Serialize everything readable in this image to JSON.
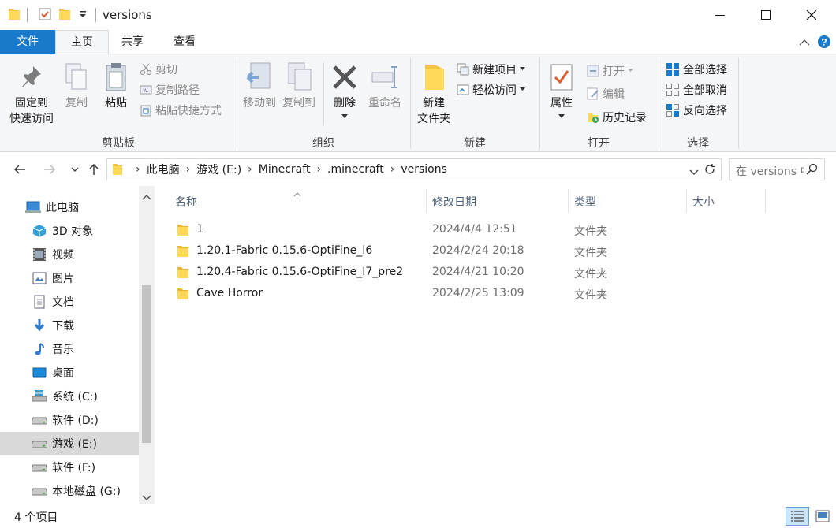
{
  "window": {
    "title": "versions",
    "minimize_label": "—",
    "maximize_label": "☐",
    "close_label": "✕"
  },
  "tabs": {
    "file": "文件",
    "home": "主页",
    "share": "共享",
    "view": "查看"
  },
  "ribbon": {
    "clipboard": {
      "label": "剪贴板",
      "pin": "固定到",
      "pin2": "快速访问",
      "copy": "复制",
      "paste": "粘贴",
      "cut": "剪切",
      "copy_path": "复制路径",
      "paste_shortcut": "粘贴快捷方式"
    },
    "organize": {
      "label": "组织",
      "move_to": "移动到",
      "copy_to": "复制到",
      "delete": "删除",
      "rename": "重命名"
    },
    "new": {
      "label": "新建",
      "new_folder": "新建",
      "new_folder2": "文件夹",
      "new_item": "新建项目",
      "easy_access": "轻松访问"
    },
    "open": {
      "label": "打开",
      "properties": "属性",
      "open": "打开",
      "edit": "编辑",
      "history": "历史记录"
    },
    "select": {
      "label": "选择",
      "select_all": "全部选择",
      "select_none": "全部取消",
      "invert": "反向选择"
    }
  },
  "address": {
    "breadcrumbs": [
      "此电脑",
      "游戏 (E:)",
      "Minecraft",
      ".minecraft",
      "versions"
    ],
    "search_placeholder": "在 versions 中搜索"
  },
  "nav": {
    "items": [
      {
        "label": "此电脑",
        "icon": "computer-icon"
      },
      {
        "label": "3D 对象",
        "icon": "3d-objects-icon"
      },
      {
        "label": "视频",
        "icon": "video-icon"
      },
      {
        "label": "图片",
        "icon": "pictures-icon"
      },
      {
        "label": "文档",
        "icon": "documents-icon"
      },
      {
        "label": "下载",
        "icon": "download-icon"
      },
      {
        "label": "音乐",
        "icon": "music-icon"
      },
      {
        "label": "桌面",
        "icon": "desktop-icon"
      },
      {
        "label": "系统 (C:)",
        "icon": "windows-drive-icon"
      },
      {
        "label": "软件 (D:)",
        "icon": "drive-icon"
      },
      {
        "label": "游戏 (E:)",
        "icon": "drive-icon"
      },
      {
        "label": "软件 (F:)",
        "icon": "drive-icon"
      },
      {
        "label": "本地磁盘 (G:)",
        "icon": "drive-icon"
      }
    ]
  },
  "columns": {
    "name": "名称",
    "date": "修改日期",
    "type": "类型",
    "size": "大小"
  },
  "files": [
    {
      "name": "1",
      "date": "2024/4/4 12:51",
      "type": "文件夹"
    },
    {
      "name": "1.20.1-Fabric 0.15.6-OptiFine_I6",
      "date": "2024/2/24 20:18",
      "type": "文件夹"
    },
    {
      "name": "1.20.4-Fabric 0.15.6-OptiFine_I7_pre2",
      "date": "2024/4/21 10:20",
      "type": "文件夹"
    },
    {
      "name": "Cave Horror",
      "date": "2024/2/25 13:09",
      "type": "文件夹"
    }
  ],
  "status": {
    "item_count": "4 个项目"
  }
}
